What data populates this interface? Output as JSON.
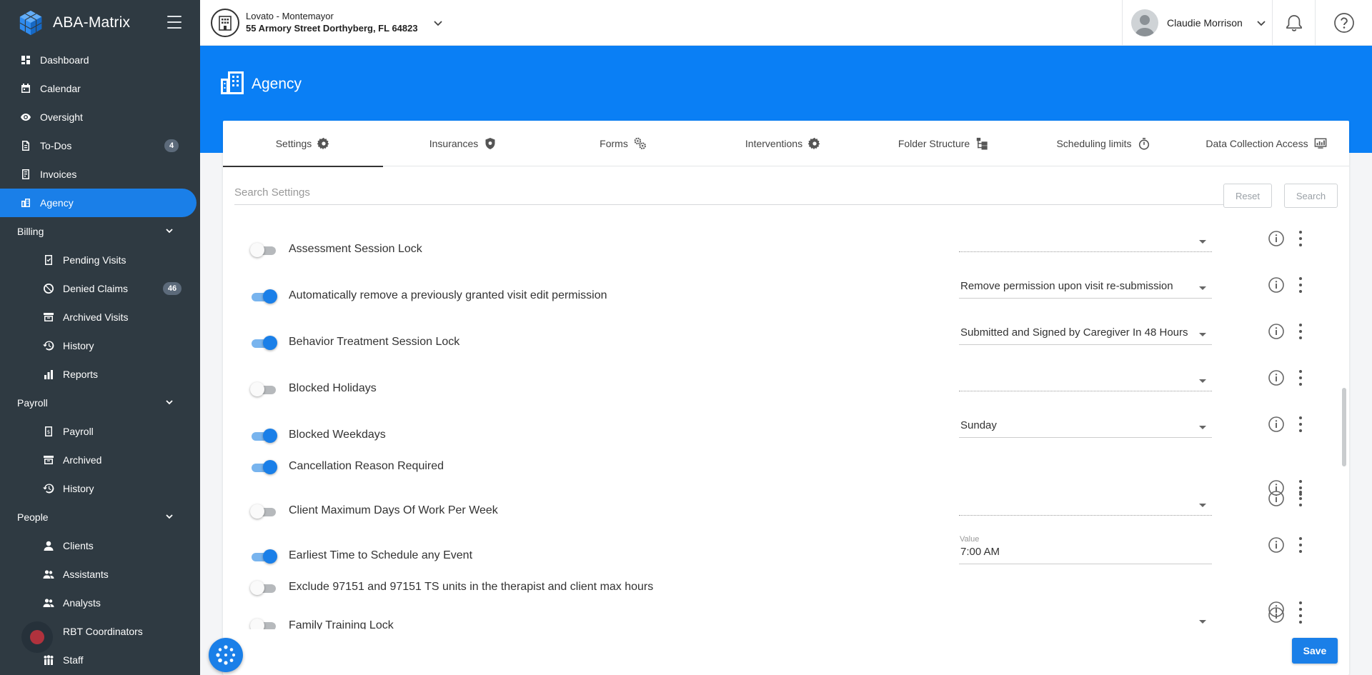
{
  "brand": {
    "name": "ABA-Matrix"
  },
  "sidebar": {
    "items": [
      {
        "label": "Dashboard",
        "icon": "dashboard-icon"
      },
      {
        "label": "Calendar",
        "icon": "calendar-icon"
      },
      {
        "label": "Oversight",
        "icon": "eye-icon"
      },
      {
        "label": "To-Dos",
        "icon": "todo-icon",
        "badge": "4"
      },
      {
        "label": "Invoices",
        "icon": "invoice-icon"
      },
      {
        "label": "Agency",
        "icon": "agency-icon",
        "active": true
      }
    ],
    "billing": {
      "label": "Billing",
      "items": [
        {
          "label": "Pending Visits"
        },
        {
          "label": "Denied Claims",
          "badge": "46"
        },
        {
          "label": "Archived Visits"
        },
        {
          "label": "History"
        },
        {
          "label": "Reports"
        }
      ]
    },
    "payroll": {
      "label": "Payroll",
      "items": [
        {
          "label": "Payroll"
        },
        {
          "label": "Archived"
        },
        {
          "label": "History"
        }
      ]
    },
    "people": {
      "label": "People",
      "items": [
        {
          "label": "Clients"
        },
        {
          "label": "Assistants"
        },
        {
          "label": "Analysts"
        },
        {
          "label": "RBT Coordinators"
        },
        {
          "label": "Staff"
        }
      ]
    }
  },
  "header": {
    "org_name": "Lovato - Montemayor",
    "org_address": "55 Armory Street Dorthyberg, FL 64823",
    "user_name": "Claudie Morrison"
  },
  "banner": {
    "title": "Agency"
  },
  "tabs": [
    {
      "label": "Settings",
      "icon": "gear-icon",
      "active": true
    },
    {
      "label": "Insurances",
      "icon": "shield-icon"
    },
    {
      "label": "Forms",
      "icon": "gears-icon"
    },
    {
      "label": "Interventions",
      "icon": "gear-icon"
    },
    {
      "label": "Folder Structure",
      "icon": "folder-tree-icon"
    },
    {
      "label": "Scheduling limits",
      "icon": "stopwatch-icon"
    },
    {
      "label": "Data Collection Access",
      "icon": "monitor-icon"
    }
  ],
  "search": {
    "placeholder": "Search Settings",
    "value": "",
    "reset_label": "Reset",
    "search_label": "Search"
  },
  "settings": [
    {
      "label": "Assessment Session Lock",
      "enabled": false,
      "select": ""
    },
    {
      "label": "Automatically remove a previously granted visit edit permission",
      "enabled": true,
      "select": "Remove permission upon visit re-submission"
    },
    {
      "label": "Behavior Treatment Session Lock",
      "enabled": true,
      "select": "Submitted and Signed by Caregiver In 48 Hours"
    },
    {
      "label": "Blocked Holidays",
      "enabled": false,
      "select": ""
    },
    {
      "label": "Blocked Weekdays",
      "enabled": true,
      "select": "Sunday"
    },
    {
      "label": "Cancellation Reason Required",
      "enabled": true
    },
    {
      "label": "Client Maximum Days Of Work Per Week",
      "enabled": false,
      "select": ""
    },
    {
      "label": "Earliest Time to Schedule any Event",
      "enabled": true,
      "input_label": "Value",
      "input_value": "7:00 AM"
    },
    {
      "label": "Exclude 97151 and 97151 TS units in the therapist and client max hours",
      "enabled": false
    },
    {
      "label": "Family Training Lock",
      "enabled": false,
      "select": ""
    }
  ],
  "footer": {
    "save_label": "Save"
  },
  "colors": {
    "accent": "#1a7fe8",
    "banner": "#0a7ff5",
    "sidebar": "#2f3a42"
  }
}
